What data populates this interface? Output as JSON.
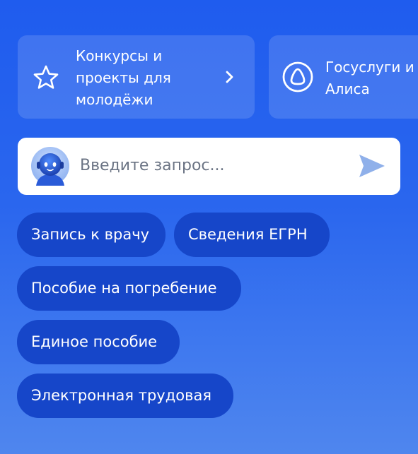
{
  "cards": {
    "youth": {
      "label": "Конкурсы и\nпроекты для\nмолодёжи",
      "icon": "star-icon"
    },
    "alice": {
      "label": "Госуслуги и\nАлиса",
      "icon": "alice-icon"
    }
  },
  "search": {
    "placeholder": "Введите запрос..."
  },
  "chips": [
    "Запись к врачу",
    "Сведения ЕГРН",
    "Пособие на погребение",
    "Единое пособие",
    "Электронная трудовая"
  ],
  "colors": {
    "background_top": "#1f5cee",
    "background_bottom": "#4f86ee",
    "chip": "#1646c9",
    "card": "rgba(255,255,255,0.14)",
    "search_bg": "#ffffff",
    "send_icon": "#8fb0ea"
  }
}
